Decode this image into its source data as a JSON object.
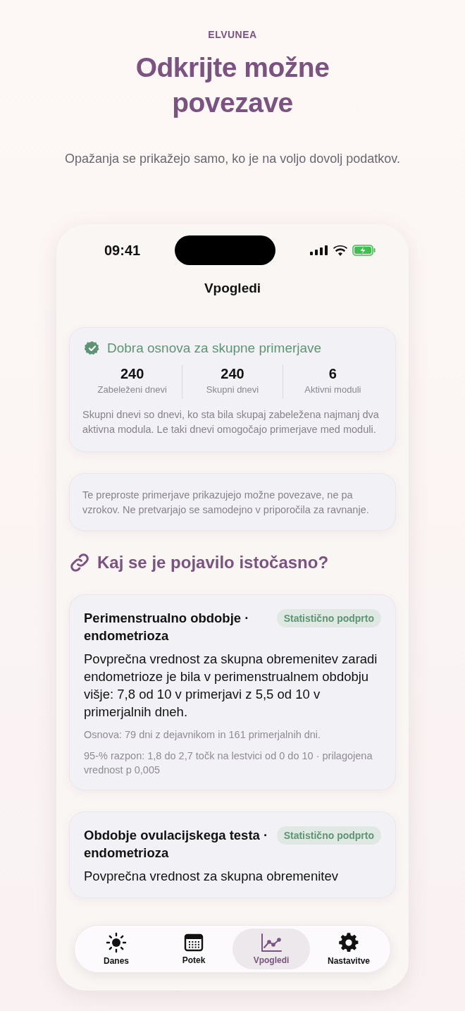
{
  "brand": "ELVUNEA",
  "headline": "Odkrijte možne povezave",
  "subtitle": "Opažanja se prikažejo samo, ko je na voljo dovolj podatkov.",
  "status_bar": {
    "time": "09:41"
  },
  "nav_title": "Vpogledi",
  "basis_card": {
    "title": "Dobra osnova za skupne primerjave",
    "verified": true,
    "stats": [
      {
        "value": "240",
        "label": "Zabeleženi dnevi"
      },
      {
        "value": "240",
        "label": "Skupni dnevi"
      },
      {
        "value": "6",
        "label": "Aktivni moduli"
      }
    ],
    "note": "Skupni dnevi so dnevi, ko sta bila skupaj zabeležena najmanj dva aktivna modula. Le taki dnevi omogočajo primerjave med moduli."
  },
  "disclaimer": "Te preproste primerjave prikazujejo možne povezave, ne pa vzrokov. Ne pretvarjajo se samodejno v priporočila za ravnanje.",
  "section_heading": "Kaj se je pojavilo istočasno?",
  "insights": [
    {
      "title": "Perimenstrualno obdobje · endometrioza",
      "badge": "Statistično podprto",
      "body": "Povprečna vrednost za skupna obremenitev zaradi endometrioze je bila v perimenstrualnem obdobju višje: 7,8 od 10 v primerjavi z 5,5 od 10 v primerjalnih dneh.",
      "details": [
        "Osnova: 79 dni z dejavnikom in 161 primerjalnih dni.",
        "95-% razpon: 1,8 do 2,7 točk na lestvici od 0 do 10 · prilagojena vrednost p 0,005"
      ]
    },
    {
      "title": "Obdobje ovulacijskega testa · endometrioza",
      "badge": "Statistično podprto",
      "body": "Povprečna vrednost za skupna obremenitev"
    }
  ],
  "tabs": [
    {
      "kind": "sun",
      "label": "Danes",
      "selected": false
    },
    {
      "kind": "calendar",
      "label": "Potek",
      "selected": false
    },
    {
      "kind": "chart",
      "label": "Vpogledi",
      "selected": true
    },
    {
      "kind": "gear",
      "label": "Nastavitve",
      "selected": false
    }
  ]
}
